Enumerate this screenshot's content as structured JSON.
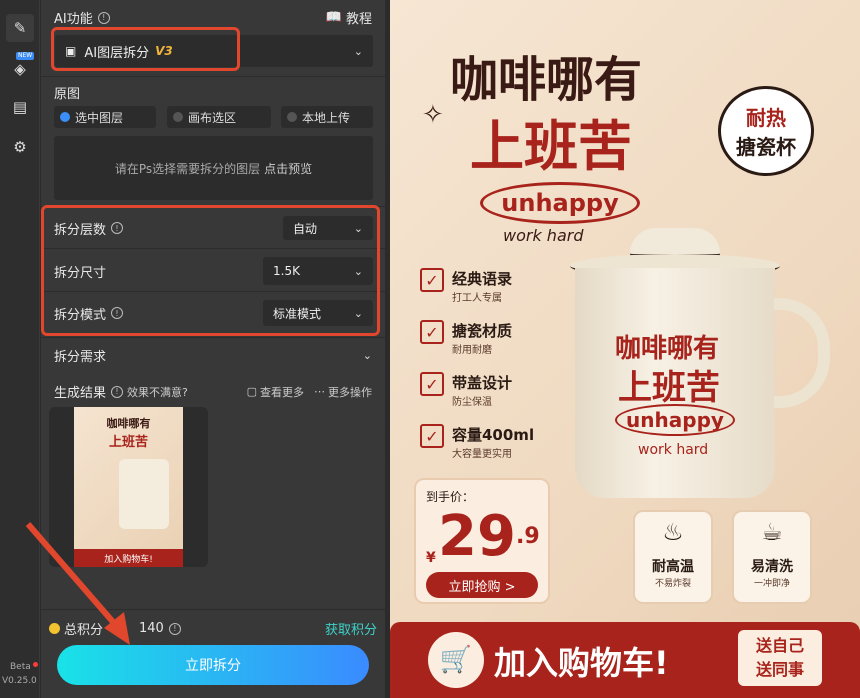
{
  "rail": {
    "beta": "Beta",
    "version": "V0.25.0",
    "new_tag": "NEW"
  },
  "panel": {
    "ai_func_label": "AI功能",
    "tutorial": "教程",
    "mode_select": "AI图层拆分",
    "mode_version": "V3",
    "original_label": "原图",
    "source_options": [
      "选中图层",
      "画布选区",
      "本地上传"
    ],
    "hint_text": "请在Ps选择需要拆分的图层",
    "hint_link": "点击预览",
    "layers_label": "拆分层数",
    "layers_value": "自动",
    "size_label": "拆分尺寸",
    "size_value": "1.5K",
    "mode_label": "拆分模式",
    "mode_value": "标准模式",
    "needs_label": "拆分需求",
    "result_label": "生成结果",
    "unsatisfied": "效果不满意?",
    "view_more": "查看更多",
    "more_ops": "更多操作",
    "points_label": "总积分",
    "points_value": "140",
    "get_points": "获取积分",
    "split_button": "立即拆分"
  },
  "poster": {
    "title1": "咖啡哪有",
    "title2": "上班苦",
    "brand": "unhappy",
    "slogan": "work hard",
    "badge1": "耐热",
    "badge2": "搪瓷杯",
    "features": [
      {
        "title": "经典语录",
        "sub": "打工人专属"
      },
      {
        "title": "搪瓷材质",
        "sub": "耐用耐磨"
      },
      {
        "title": "带盖设计",
        "sub": "防尘保温"
      },
      {
        "title": "容量400ml",
        "sub": "大容量更实用"
      }
    ],
    "mug_title1": "咖啡哪有",
    "mug_title2": "上班苦",
    "mug_brand": "unhappy",
    "mug_slogan": "work hard",
    "price_label": "到手价：",
    "currency": "¥",
    "price_int": "29",
    "price_dec": ".9",
    "buy": "立即抢购 >",
    "tag1_title": "耐高温",
    "tag1_sub": "不易炸裂",
    "tag2_title": "易清洗",
    "tag2_sub": "一冲即净",
    "cart": "加入购物车!",
    "gift1": "送自己",
    "gift2": "送同事"
  },
  "colors": {
    "accent": "#e0472d",
    "brand_red": "#a8231b",
    "button_start": "#19e2e7",
    "button_end": "#3a8bff"
  }
}
